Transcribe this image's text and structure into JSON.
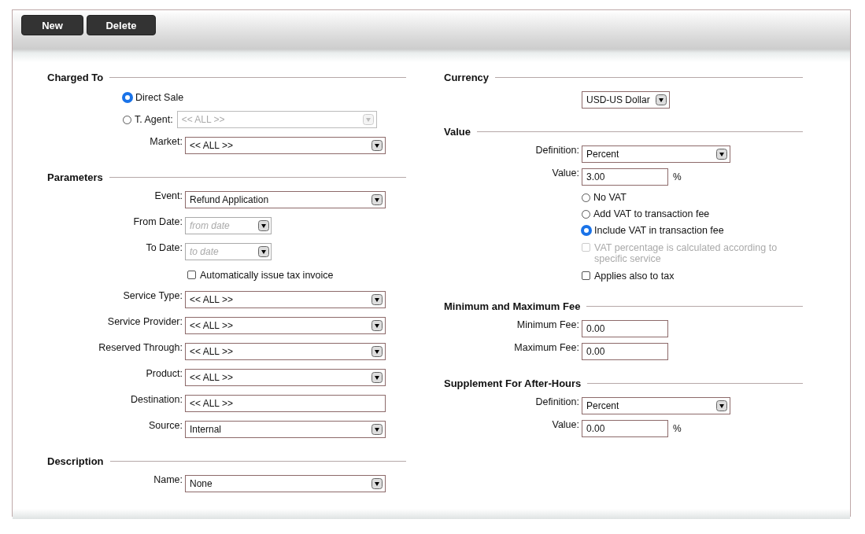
{
  "toolbar": {
    "buttons": [
      "New",
      "Delete"
    ]
  },
  "columns": [
    {
      "sections": [
        {
          "title": "Charged To",
          "rows": [
            {
              "kind": "radio",
              "label": "Direct Sale",
              "selected": true
            },
            {
              "kind": "radio",
              "label": "T. Agent:",
              "selected": false,
              "field": {
                "kind": "select",
                "value": "<< ALL >>",
                "disabled": true
              }
            },
            {
              "kind": "field",
              "label": "Market:",
              "field": {
                "kind": "select",
                "value": "<< ALL >>",
                "disabled": false
              }
            }
          ]
        },
        {
          "title": "Parameters",
          "rows": [
            {
              "kind": "field",
              "label": "Event:",
              "field": {
                "kind": "select",
                "value": "Refund Application",
                "disabled": false
              }
            },
            {
              "kind": "field",
              "label": "From Date:",
              "field": {
                "kind": "date",
                "placeholder": "from date",
                "disabled": false
              }
            },
            {
              "kind": "field",
              "label": "To Date:",
              "field": {
                "kind": "date",
                "placeholder": "to date",
                "disabled": false
              }
            },
            {
              "kind": "checkbox",
              "label": "Automatically issue tax invoice",
              "checked": false,
              "disabled": false
            },
            {
              "kind": "field",
              "label": "Service Type:",
              "field": {
                "kind": "select",
                "value": "<< ALL >>",
                "disabled": false
              }
            },
            {
              "kind": "field",
              "label": "Service Provider:",
              "field": {
                "kind": "select",
                "value": "<< ALL >>",
                "disabled": false
              }
            },
            {
              "kind": "field",
              "label": "Reserved Through:",
              "field": {
                "kind": "select",
                "value": "<< ALL >>",
                "disabled": false
              }
            },
            {
              "kind": "field",
              "label": "Product:",
              "field": {
                "kind": "select",
                "value": "<< ALL >>",
                "disabled": false
              }
            },
            {
              "kind": "field",
              "label": "Destination:",
              "field": {
                "kind": "text",
                "value": "<< ALL >>",
                "disabled": false
              }
            },
            {
              "kind": "field",
              "label": "Source:",
              "field": {
                "kind": "select",
                "value": "Internal",
                "disabled": false
              }
            }
          ]
        },
        {
          "title": "Description",
          "rows": [
            {
              "kind": "field",
              "label": "Name:",
              "field": {
                "kind": "select",
                "value": "None",
                "disabled": false
              }
            }
          ]
        }
      ]
    },
    {
      "sections": [
        {
          "title": "Currency",
          "rows": [
            {
              "kind": "field",
              "field": {
                "kind": "select",
                "value": "USD-US Dollar",
                "disabled": false
              }
            }
          ]
        },
        {
          "title": "Value",
          "rows": [
            {
              "kind": "field",
              "label": "Definition:",
              "field": {
                "kind": "select",
                "value": "Percent",
                "disabled": false
              }
            },
            {
              "kind": "field",
              "label": "Value:",
              "field": {
                "kind": "text",
                "value": "3.00",
                "suffix": "%",
                "disabled": false
              }
            },
            {
              "kind": "radio",
              "label": "No VAT",
              "selected": false
            },
            {
              "kind": "radio",
              "label": "Add VAT to transaction fee",
              "selected": false
            },
            {
              "kind": "radio",
              "label": "Include VAT in transaction fee",
              "selected": true
            },
            {
              "kind": "checkbox",
              "label": "VAT percentage is calculated according to specific service",
              "checked": false,
              "disabled": true
            },
            {
              "kind": "checkbox",
              "label": "Applies also to tax",
              "checked": false,
              "disabled": false
            }
          ]
        },
        {
          "title": "Minimum and Maximum Fee",
          "rows": [
            {
              "kind": "field",
              "label": "Minimum Fee:",
              "field": {
                "kind": "text",
                "value": "0.00",
                "disabled": false
              }
            },
            {
              "kind": "field",
              "label": "Maximum Fee:",
              "field": {
                "kind": "text",
                "value": "0.00",
                "disabled": false
              }
            }
          ]
        },
        {
          "title": "Supplement For After-Hours",
          "rows": [
            {
              "kind": "field",
              "label": "Definition:",
              "field": {
                "kind": "select",
                "value": "Percent",
                "disabled": false
              }
            },
            {
              "kind": "field",
              "label": "Value:",
              "field": {
                "kind": "text",
                "value": "0.00",
                "suffix": "%",
                "disabled": false
              }
            }
          ]
        }
      ]
    }
  ]
}
